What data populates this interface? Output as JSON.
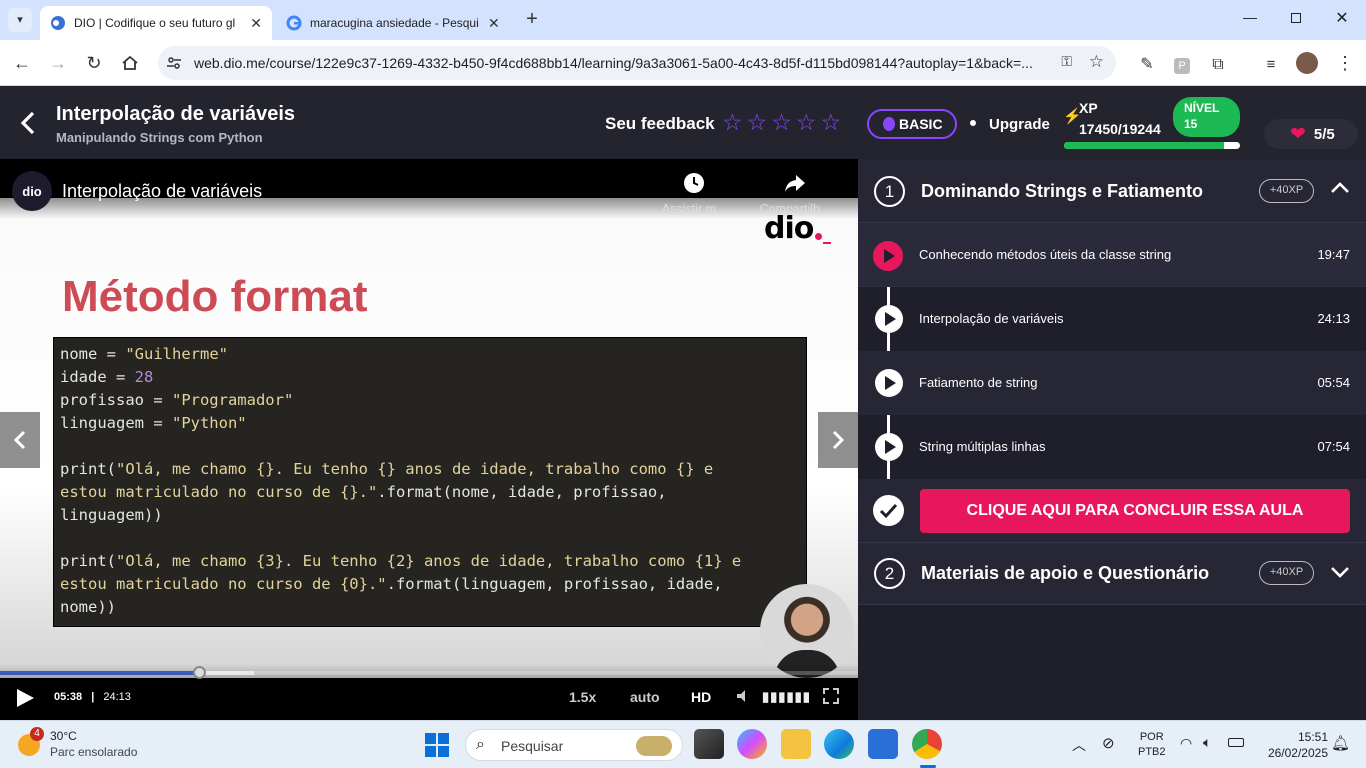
{
  "browser": {
    "tabs": [
      {
        "title": "DIO | Codifique o seu futuro gl",
        "active": true
      },
      {
        "title": "maracugina ansiedade - Pesqui",
        "active": false
      }
    ],
    "url": "web.dio.me/course/122e9c37-1269-4332-b450-9f4cd688bb14/learning/9a3a3061-5a00-4c43-8d5f-d115bd098144?autoplay=1&back=..."
  },
  "header": {
    "title": "Interpolação de variáveis",
    "subtitle": "Manipulando Strings com Python",
    "feedback_label": "Seu feedback",
    "plan_badge": "BASIC",
    "upgrade_label": "Upgrade",
    "xp_label": "XP",
    "xp_value": "17450/19244",
    "xp_progress": 0.907,
    "level_label": "NÍVEL",
    "level_value": "15",
    "lives": "5/5"
  },
  "video": {
    "title": "Interpolação de variáveis",
    "watch_later": "Assistir m...",
    "share": "Compartilh...",
    "slide_title": "Método format",
    "code_lines": [
      [
        {
          "t": "nome = ",
          "c": ""
        },
        {
          "t": "\"Guilherme\"",
          "c": "s"
        }
      ],
      [
        {
          "t": "idade = ",
          "c": ""
        },
        {
          "t": "28",
          "c": "n"
        }
      ],
      [
        {
          "t": "profissao = ",
          "c": ""
        },
        {
          "t": "\"Programador\"",
          "c": "s"
        }
      ],
      [
        {
          "t": "linguagem = ",
          "c": ""
        },
        {
          "t": "\"Python\"",
          "c": "s"
        }
      ],
      [
        {
          "t": " ",
          "c": ""
        }
      ],
      [
        {
          "t": "print(",
          "c": ""
        },
        {
          "t": "\"Olá, me chamo {}. Eu tenho {} anos de idade, trabalho como {} e",
          "c": "s"
        }
      ],
      [
        {
          "t": "estou matriculado no curso de {}.\"",
          "c": "s"
        },
        {
          "t": ".format(nome, idade, profissao,",
          "c": ""
        }
      ],
      [
        {
          "t": "linguagem))",
          "c": ""
        }
      ],
      [
        {
          "t": " ",
          "c": ""
        }
      ],
      [
        {
          "t": "print(",
          "c": ""
        },
        {
          "t": "\"Olá, me chamo {3}. Eu tenho {2} anos de idade, trabalho como {1} e",
          "c": "s"
        }
      ],
      [
        {
          "t": "estou matriculado no curso de {0}.\"",
          "c": "s"
        },
        {
          "t": ".format(linguagem, profissao, idade,",
          "c": ""
        }
      ],
      [
        {
          "t": "nome))",
          "c": ""
        }
      ]
    ],
    "current_time": "05:38",
    "separator": "|",
    "duration": "24:13",
    "progress": 0.233,
    "speed": "1.5x",
    "quality": "auto",
    "hd": "HD"
  },
  "sidebar": {
    "sections": [
      {
        "number": "1",
        "title": "Dominando Strings e Fatiamento",
        "xp": "+40XP",
        "expanded": true
      },
      {
        "number": "2",
        "title": "Materiais de apoio e Questionário",
        "xp": "+40XP",
        "expanded": false
      }
    ],
    "lessons": [
      {
        "title": "Conhecendo métodos úteis da classe string",
        "duration": "19:47"
      },
      {
        "title": "Interpolação de variáveis",
        "duration": "24:13"
      },
      {
        "title": "Fatiamento de string",
        "duration": "05:54"
      },
      {
        "title": "String múltiplas linhas",
        "duration": "07:54"
      }
    ],
    "complete_button": "CLIQUE AQUI PARA CONCLUIR ESSA AULA"
  },
  "taskbar": {
    "weather_temp": "30°C",
    "weather_desc": "Parc ensolarado",
    "weather_badge": "4",
    "search_placeholder": "Pesquisar",
    "lang1": "POR",
    "lang2": "PTB2",
    "time": "15:51",
    "date": "26/02/2025"
  },
  "colors": {
    "accent_pink": "#e8175d",
    "purple": "#8a45ff",
    "green": "#1db954",
    "header_bg": "#24242f",
    "sidebar_bg": "#1f1f2b"
  }
}
